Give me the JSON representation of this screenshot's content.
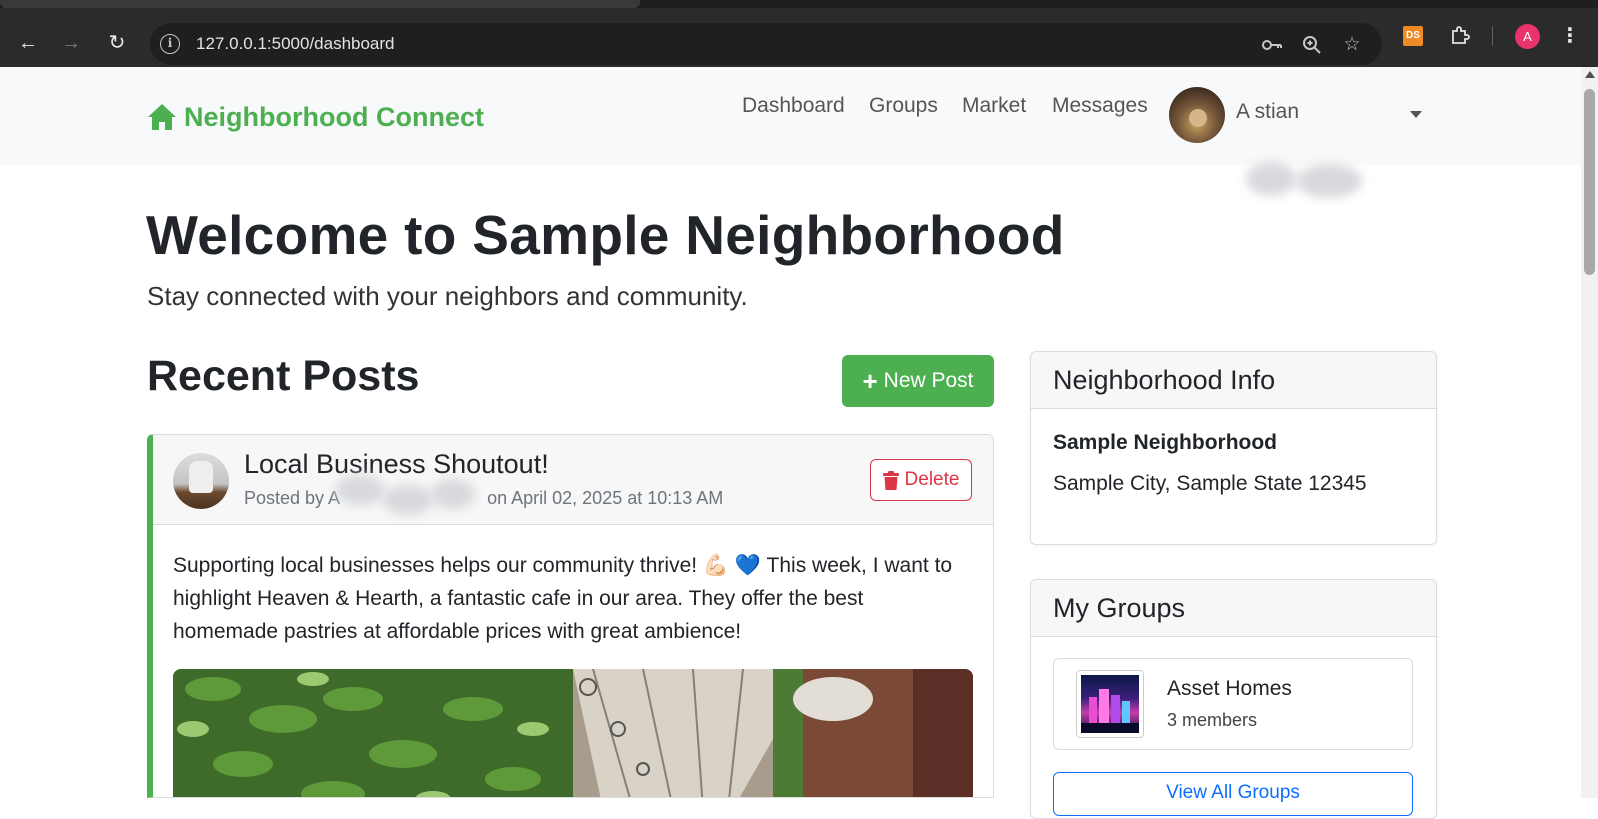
{
  "browser": {
    "url": "127.0.0.1:5000/dashboard",
    "ext_label": "DS",
    "profile_initial": "A",
    "icons": [
      "back-icon",
      "forward-icon",
      "reload-icon",
      "info-icon",
      "password-key-icon",
      "zoom-icon",
      "bookmark-star-icon",
      "extensions-puzzle-icon",
      "chrome-menu-icon"
    ]
  },
  "navbar": {
    "brand": "Neighborhood Connect",
    "links": [
      "Dashboard",
      "Groups",
      "Market",
      "Messages"
    ],
    "user_name_visible": "A        stian"
  },
  "hero": {
    "title": "Welcome to Sample Neighborhood",
    "subtitle": "Stay connected with your neighbors and community."
  },
  "posts_section": {
    "title": "Recent Posts",
    "new_post_label": "New Post"
  },
  "post": {
    "title": "Local Business Shoutout!",
    "meta_prefix": "Posted by A",
    "meta_suffix": "on April 02, 2025 at 10:13 AM",
    "delete_label": "Delete",
    "body": "Supporting local businesses helps our community thrive! 💪🏻 💙 This week, I want to highlight Heaven & Hearth, a fantastic cafe in our area. They offer the best homemade pastries at affordable prices with great ambience!"
  },
  "info_card": {
    "title": "Neighborhood Info",
    "name": "Sample Neighborhood",
    "address": "Sample City, Sample State 12345"
  },
  "groups_card": {
    "title": "My Groups",
    "groups": [
      {
        "name": "Asset Homes",
        "members": "3 members"
      }
    ],
    "view_all_label": "View All Groups"
  },
  "colors": {
    "brand_green": "#4caf50",
    "danger": "#dc3545",
    "primary": "#0d6efd"
  }
}
